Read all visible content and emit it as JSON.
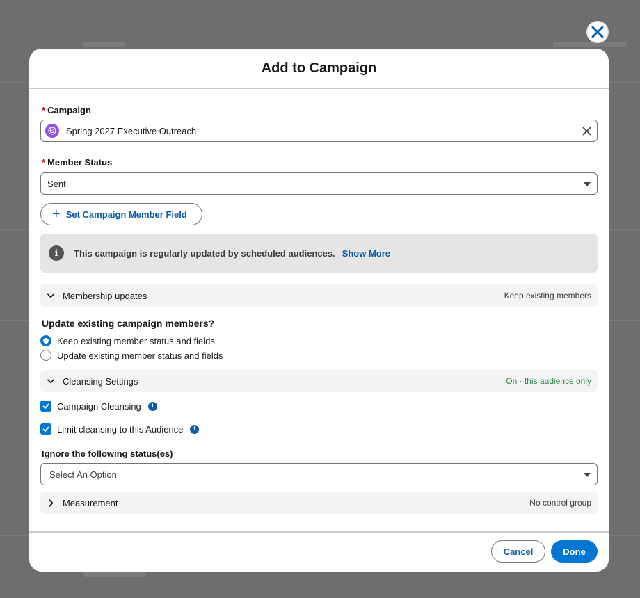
{
  "modal": {
    "title": "Add to Campaign"
  },
  "campaign": {
    "label": "Campaign",
    "required_mark": "*",
    "value": "Spring 2027 Executive Outreach",
    "icon": "campaign-target-icon"
  },
  "member_status": {
    "label": "Member Status",
    "required_mark": "*",
    "value": "Sent"
  },
  "set_field_button": {
    "label": "Set Campaign Member Field"
  },
  "info_banner": {
    "text": "This campaign is regularly updated by scheduled audiences.",
    "link": "Show More"
  },
  "membership_updates": {
    "label": "Membership updates",
    "summary": "Keep existing members",
    "expanded": true
  },
  "update_question": {
    "label": "Update existing campaign members?",
    "options": [
      {
        "label": "Keep existing member status and fields",
        "selected": true
      },
      {
        "label": "Update existing member status and fields",
        "selected": false
      }
    ]
  },
  "cleansing_settings": {
    "label": "Cleansing Settings",
    "summary": "On · this audience only",
    "expanded": true
  },
  "checkboxes": [
    {
      "label": "Campaign Cleansing",
      "checked": true
    },
    {
      "label": "Limit cleansing to this Audience",
      "checked": true
    }
  ],
  "ignore_statuses": {
    "label": "Ignore the following status(es)",
    "placeholder": "Select An Option"
  },
  "measurement": {
    "label": "Measurement",
    "summary": "No control group",
    "expanded": false
  },
  "footer": {
    "cancel_label": "Cancel",
    "done_label": "Done"
  },
  "colors": {
    "brand": "#0176d3",
    "link": "#0b5cab",
    "required": "#ba0517",
    "success_text": "#2e844a",
    "campaign_icon": "#9050e9"
  }
}
